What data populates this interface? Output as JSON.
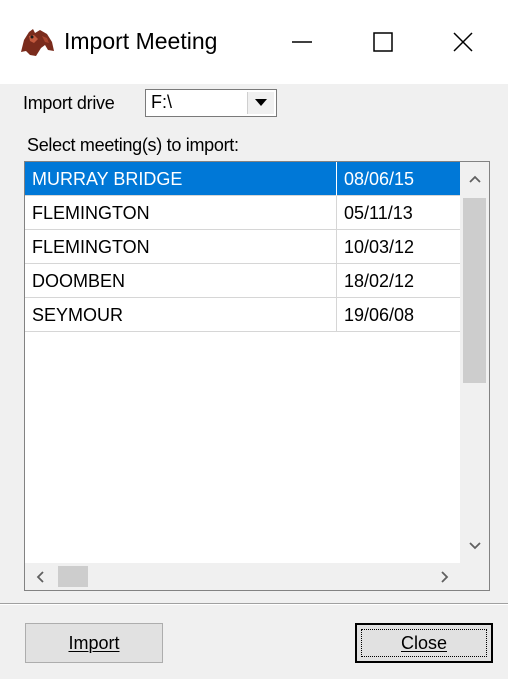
{
  "window": {
    "title": "Import Meeting",
    "controls": {
      "minimize": "minimize-icon",
      "maximize": "maximize-icon",
      "close": "close-icon"
    }
  },
  "import_drive": {
    "label": "Import drive",
    "value": "F:\\"
  },
  "meetings": {
    "label": "Select meeting(s) to import:",
    "rows": [
      {
        "name": "MURRAY BRIDGE",
        "date": "08/06/15",
        "selected": true
      },
      {
        "name": "FLEMINGTON",
        "date": "05/11/13",
        "selected": false
      },
      {
        "name": "FLEMINGTON",
        "date": "10/03/12",
        "selected": false
      },
      {
        "name": "DOOMBEN",
        "date": "18/02/12",
        "selected": false
      },
      {
        "name": "SEYMOUR",
        "date": "19/06/08",
        "selected": false
      }
    ]
  },
  "buttons": {
    "import_label": "Import",
    "close_label": "Close"
  },
  "colors": {
    "selection": "#0078d7",
    "dialog_bg": "#f0f0f0"
  }
}
